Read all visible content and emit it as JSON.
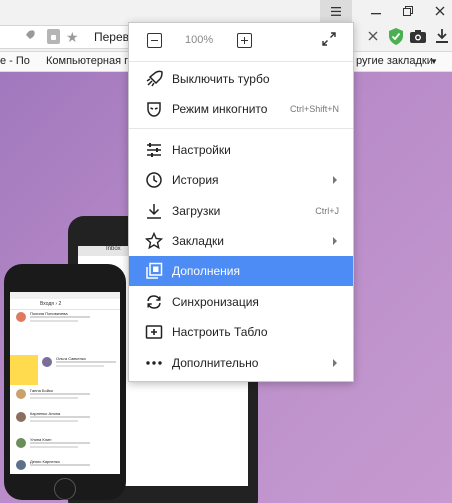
{
  "browser": {
    "page_title": "Перевe",
    "bookmarks": {
      "items": [
        "e - По",
        "Компьютерная гр",
        "ругие закладки"
      ]
    }
  },
  "menu": {
    "zoom_value": "100%",
    "items": [
      {
        "label": "Выключить турбо",
        "shortcut": "",
        "submenu": false
      },
      {
        "label": "Режим инкогнито",
        "shortcut": "Ctrl+Shift+N",
        "submenu": false
      },
      {
        "label": "Настройки",
        "shortcut": "",
        "submenu": false
      },
      {
        "label": "История",
        "shortcut": "",
        "submenu": true
      },
      {
        "label": "Загрузки",
        "shortcut": "Ctrl+J",
        "submenu": false
      },
      {
        "label": "Закладки",
        "shortcut": "",
        "submenu": true
      },
      {
        "label": "Дополнения",
        "shortcut": "",
        "submenu": false
      },
      {
        "label": "Синхронизация",
        "shortcut": "",
        "submenu": false
      },
      {
        "label": "Настроить Табло",
        "shortcut": "",
        "submenu": false
      },
      {
        "label": "Дополнительно",
        "shortcut": "",
        "submenu": true
      }
    ],
    "highlight_color": "#4d8cf5"
  },
  "mockup": {
    "tablet_inbox": "Inbox",
    "phone_header": "Входя › 2",
    "phone_names": [
      "Полина Поповичева",
      "Ольга Савченко",
      "Ганна Бойко",
      "Карпенко Алина",
      "Улина Клин",
      "Денис Карпенко"
    ]
  }
}
